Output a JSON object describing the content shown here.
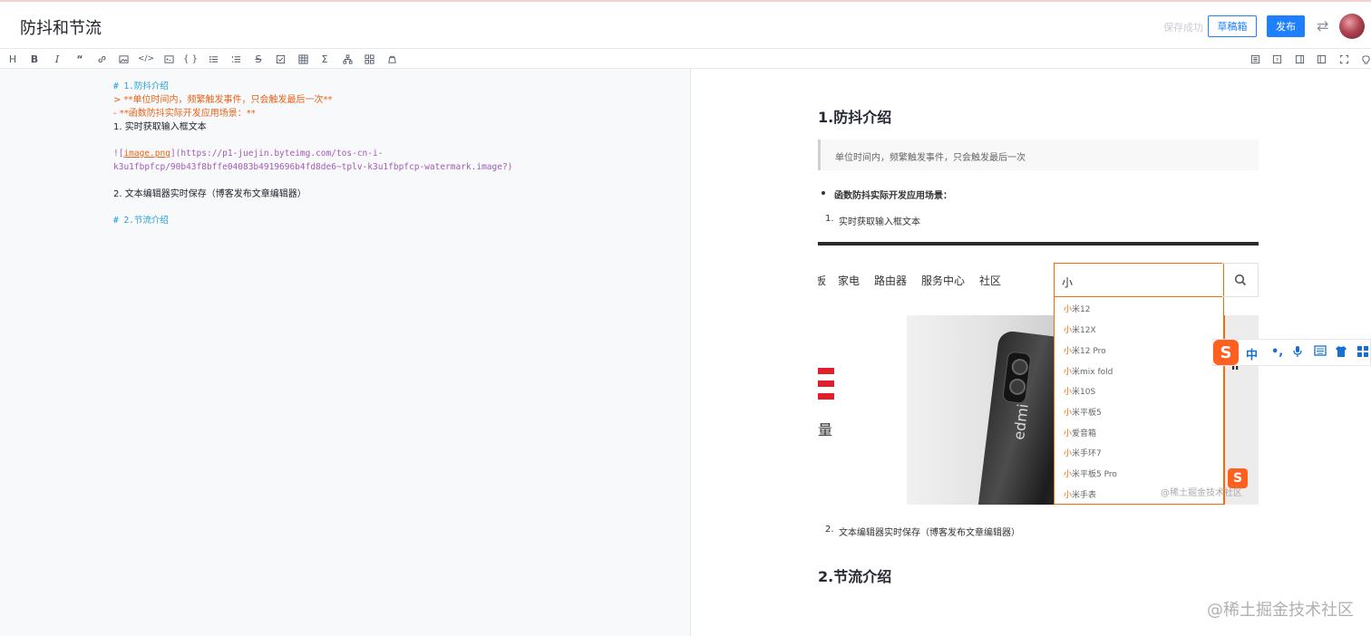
{
  "header": {
    "title": "防抖和节流",
    "save_status": "保存成功",
    "draft_label": "草稿箱",
    "publish_label": "发布"
  },
  "toolbar": {
    "left_icons": [
      "heading-icon",
      "bold-icon",
      "italic-icon",
      "quote-icon",
      "link-icon",
      "image-icon",
      "code-icon",
      "code-block-icon",
      "braces-icon",
      "unordered-list-icon",
      "ordered-list-icon",
      "strikethrough-icon",
      "checkbox-icon",
      "table-icon",
      "formula-icon",
      "diagram-icon",
      "mindmap-icon",
      "theme-icon"
    ],
    "right_icons": [
      "toc-icon",
      "help-icon",
      "editor-only-icon",
      "preview-only-icon",
      "fullscreen-icon",
      "github-icon"
    ]
  },
  "editor": {
    "lines": [
      "# 1.防抖介绍",
      "> **单位时间内，频繁触发事件，只会触发最后一次**",
      "- **函数防抖实际开发应用场景：**",
      "1. 实时获取输入框文本",
      "",
      "![image.png](https://p1-juejin.byteimg.com/tos-cn-i-",
      "k3u1fbpfcp/90b43f8bffe04083b4919696b4fd8de6~tplv-k3u1fbpfcp-watermark.image?)",
      "",
      "2. 文本编辑器实时保存（博客发布文章编辑器）",
      "",
      "# 2.节流介绍"
    ],
    "img_prefix": "![",
    "img_alt": "image.png",
    "img_mid": "](https://p1-juejin.byteimg.com/tos-cn-i-",
    "img_url2": "k3u1fbpfcp/90b43f8bffe04083b4919696b4fd8de6~tplv-k3u1fbpfcp-watermark.image?)"
  },
  "preview": {
    "h1_1": "1.防抖介绍",
    "quote": "单位时间内，频繁触发事件，只会触发最后一次",
    "bullet": "函数防抖实际开发应用场景：",
    "ol_1": "实时获取输入框文本",
    "ol_1_num": "1.",
    "ol_2": "文本编辑器实时保存（博客发布文章编辑器）",
    "ol_2_num": "2.",
    "h1_2": "2.节流介绍",
    "embed": {
      "nav_items": [
        "板",
        "家电",
        "路由器",
        "服务中心",
        "社区"
      ],
      "search_text": "小",
      "suggestions": [
        {
          "hl": "小",
          "rest": "米12"
        },
        {
          "hl": "小",
          "rest": "米12X"
        },
        {
          "hl": "小",
          "rest": "米12 Pro"
        },
        {
          "hl": "小",
          "rest": "米mix fold"
        },
        {
          "hl": "小",
          "rest": "米10S"
        },
        {
          "hl": "小",
          "rest": "米平板5"
        },
        {
          "hl": "小",
          "rest": "爱音箱"
        },
        {
          "hl": "小",
          "rest": "米手环7"
        },
        {
          "hl": "小",
          "rest": "米平板5 Pro"
        },
        {
          "hl": "小",
          "rest": "米手表"
        }
      ],
      "left_char": "量",
      "phone_brand": "edmi",
      "pause_glyph": "ıı",
      "watermark": "@稀土掘金技术社区"
    }
  },
  "ime": {
    "logo": "S",
    "items": [
      "中",
      "•,",
      "🎤",
      "⌨",
      "👕",
      "▦"
    ]
  },
  "footer_watermark": "@稀土掘金技术社区",
  "colors": {
    "accent": "#1e80ff",
    "md_heading": "#1e9fd8",
    "md_emphasis": "#e8641b",
    "md_url": "#a35ab6",
    "mi_orange": "#ff6700"
  }
}
